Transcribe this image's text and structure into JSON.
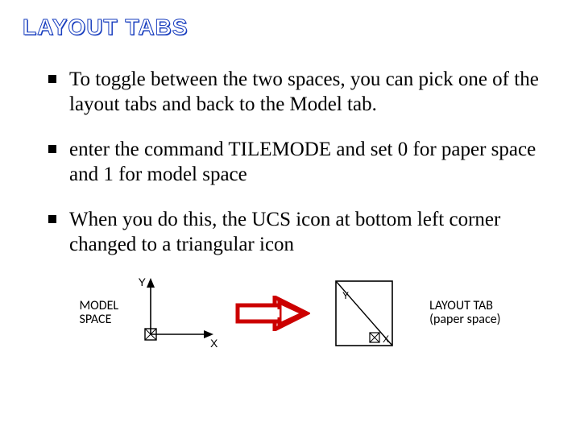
{
  "title": "LAYOUT TABS",
  "bullets": [
    "To toggle between the two spaces, you can pick one of the layout tabs and back to the Model tab.",
    "enter the command TILEMODE and set  0 for paper space and 1 for model space",
    "When you do this, the UCS icon at bottom left corner changed to a triangular icon"
  ],
  "icons": {
    "model_label": "MODEL\nSPACE",
    "layout_label": "LAYOUT TAB\n(paper space)",
    "axis_y": "Y",
    "axis_x": "X",
    "tri_y": "Y",
    "tri_x": "X"
  },
  "colors": {
    "title_stroke": "#1a3fbf",
    "arrow": "#cc0000"
  }
}
